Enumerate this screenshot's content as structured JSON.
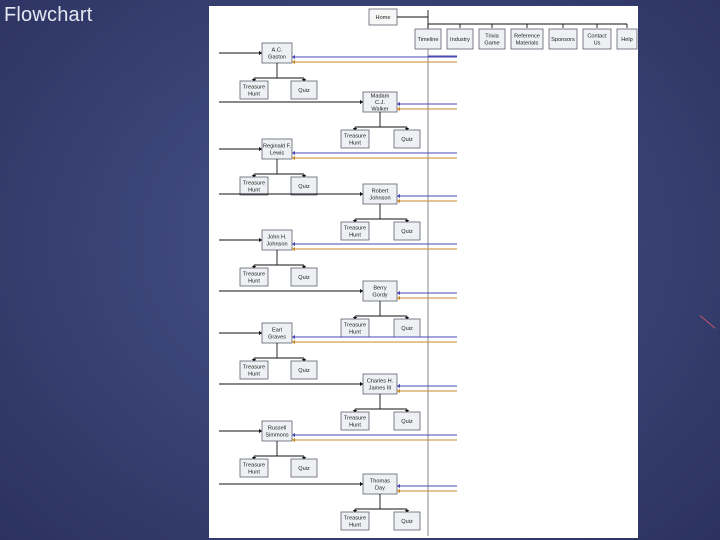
{
  "slide": {
    "title": "Flowchart"
  },
  "flowchart": {
    "home": "Home",
    "nav": [
      "Timeline",
      "Industry",
      "Trivia|Game",
      "Reference|Materials",
      "Sponsors",
      "Contact|Us",
      "Help"
    ],
    "people": [
      "A.C.|Gaston",
      "Madam|C.J.|Walker",
      "Reginald F.|Lewis",
      "Robert|Johnson",
      "John H.|Johnson",
      "Berry|Gordy",
      "Earl|Graves",
      "Charles H.|James III",
      "Russell|Simmons",
      "Thomas|Day"
    ],
    "activities": {
      "hunt": "Treasure|Hunt",
      "quiz": "Quiz"
    }
  }
}
